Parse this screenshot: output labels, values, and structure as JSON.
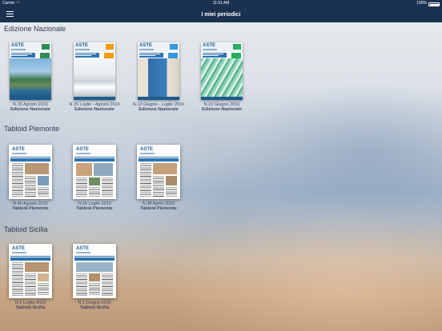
{
  "status": {
    "carrier": "Carrier",
    "time": "11:51 AM",
    "battery": "100%"
  },
  "nav": {
    "title": "I miei periodici"
  },
  "sections": [
    {
      "title": "Edizione Nazionale",
      "issues": [
        {
          "number": "N.16 Agosto 2016",
          "edition": "Edizione Nazionale",
          "accent": "#2e8b57",
          "photo": "coast"
        },
        {
          "number": "N.15 Luglio - Agosto 2016",
          "edition": "Edizione Nazionale",
          "accent": "#f39c12",
          "photo": "interior"
        },
        {
          "number": "N.13 Giugno - Luglio 2016",
          "edition": "Edizione Nazionale",
          "accent": "#3498db",
          "photo": "door"
        },
        {
          "number": "N.10 Giugno 2016",
          "edition": "Edizione Nazionale",
          "accent": "#27ae60",
          "photo": "glass"
        }
      ]
    },
    {
      "title": "Tabloid Piemonte",
      "issues": [
        {
          "number": "N.40 Agosto 2016",
          "edition": "Tabloid Piemonte"
        },
        {
          "number": "N.39 Luglio 2016",
          "edition": "Tabloid Piemonte"
        },
        {
          "number": "N.38 Aprile 2016",
          "edition": "Tabloid Piemonte"
        }
      ]
    },
    {
      "title": "Tabloid Sicilia",
      "issues": [
        {
          "number": "N.2 Luglio 2016",
          "edition": "Tabloid Sicilia"
        },
        {
          "number": "N.1 Giugno 2016",
          "edition": "Tabloid Sicilia"
        }
      ]
    }
  ],
  "cover_logo": {
    "main": "ASTE",
    "sub": "GIUDIZIARIE"
  },
  "icons": {
    "menu": "hamburger-menu-icon",
    "wifi": "wifi-icon",
    "battery": "battery-icon"
  },
  "colors": {
    "nav_background": "#1b3150",
    "logo_blue": "#1a5d92"
  }
}
